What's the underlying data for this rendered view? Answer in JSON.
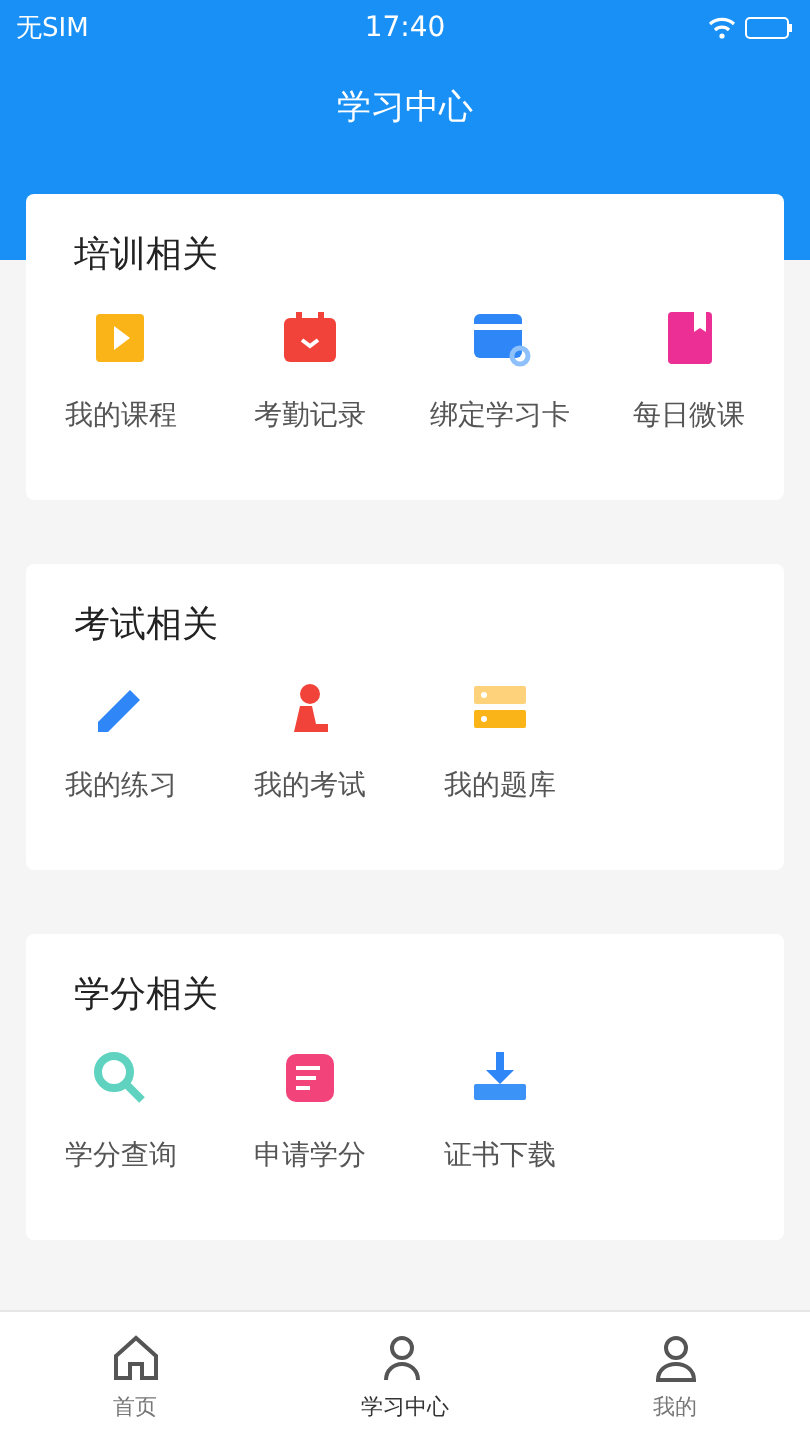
{
  "status_bar": {
    "carrier": "无SIM",
    "time": "17:40"
  },
  "header": {
    "title": "学习中心"
  },
  "sections": [
    {
      "title": "培训相关",
      "items": [
        "我的课程",
        "考勤记录",
        "绑定学习卡",
        "每日微课"
      ]
    },
    {
      "title": "考试相关",
      "items": [
        "我的练习",
        "我的考试",
        "我的题库"
      ]
    },
    {
      "title": "学分相关",
      "items": [
        "学分查询",
        "申请学分",
        "证书下载"
      ]
    }
  ],
  "tabs": [
    {
      "label": "首页",
      "selected": false
    },
    {
      "label": "学习中心",
      "selected": true
    },
    {
      "label": "我的",
      "selected": false
    }
  ]
}
